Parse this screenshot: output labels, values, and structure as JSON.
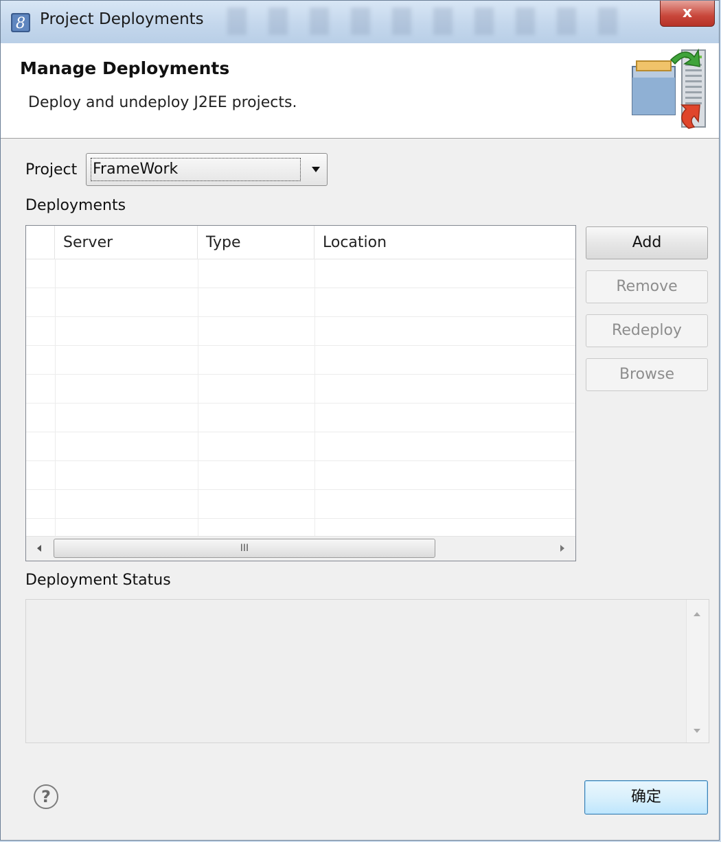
{
  "window": {
    "title": "Project Deployments",
    "close_label": "x"
  },
  "banner": {
    "heading": "Manage Deployments",
    "description": "Deploy and undeploy J2EE projects."
  },
  "project": {
    "label": "Project",
    "selected": "FrameWork"
  },
  "deployments": {
    "label": "Deployments",
    "columns": [
      "Server",
      "Type",
      "Location"
    ],
    "rows": [],
    "scroll_thumb_label": "III"
  },
  "buttons": {
    "add": "Add",
    "remove": "Remove",
    "redeploy": "Redeploy",
    "browse": "Browse",
    "ok": "确定"
  },
  "status": {
    "label": "Deployment Status",
    "text": ""
  },
  "help": {
    "glyph": "?"
  },
  "icons": [
    "app-icon",
    "deploy-banner-icon",
    "help-icon",
    "close-icon",
    "dropdown-arrow-icon"
  ],
  "colors": {
    "titlebar": "#c4d7ec",
    "close_button": "#c8463a",
    "ok_button_border": "#3c7fb1",
    "disabled_text": "#8d8d8d"
  }
}
